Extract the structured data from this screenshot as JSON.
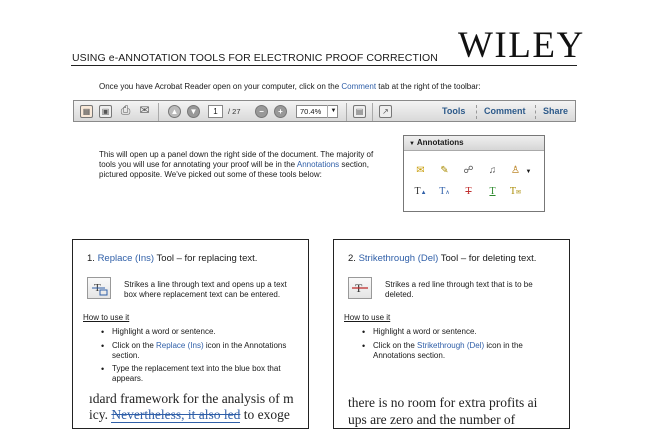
{
  "header": {
    "title": "USING e-ANNOTATION TOOLS FOR ELECTRONIC PROOF CORRECTION",
    "logo": "WILEY"
  },
  "intro": {
    "before": "Once you have Acrobat Reader open on your computer, click on the ",
    "link": "Comment",
    "after": " tab at the right of the toolbar:"
  },
  "toolbar": {
    "icons": [
      "create-pdf-icon",
      "save-icon",
      "print-icon",
      "email-icon",
      "page-up-icon",
      "page-down-icon",
      "zoom-out-icon",
      "zoom-in-icon",
      "fit-page-icon",
      "read-mode-icon"
    ],
    "page_value": "1",
    "page_total": "/ 27",
    "zoom_value": "70.4%",
    "tools_label": "Tools",
    "comment_label": "Comment",
    "share_label": "Share"
  },
  "panel_text": {
    "line1": "This will open up a panel down the right side of the document. The majority of",
    "line2_before": "tools you will use for annotating your proof will be in the ",
    "line2_link": "Annotations",
    "line2_after": " section,",
    "line3": "pictured opposite. We've picked out some of these tools below:"
  },
  "annotations_panel": {
    "title": "Annotations",
    "icons": [
      "sticky-note-icon",
      "highlight-icon",
      "attach-file-icon",
      "record-audio-icon",
      "stamp-icon",
      "replace-text-icon",
      "insert-text-icon",
      "strikethrough-icon",
      "underline-icon",
      "add-note-to-text-icon"
    ]
  },
  "box1": {
    "number": "1. ",
    "tool_link": "Replace (Ins)",
    "tool_rest": " Tool – for replacing text.",
    "desc_line1": "Strikes a line through text and opens up a text",
    "desc_line2": "box where replacement text can be entered.",
    "how_label": "How to use it",
    "bullet1": "Highlight a word or sentence.",
    "bullet2_before": "Click on the ",
    "bullet2_link": "Replace (Ins)",
    "bullet2_after": " icon in the Annotations",
    "bullet2_line2": "section.",
    "bullet3_line1": "Type the replacement text into the blue box that",
    "bullet3_line2": "appears.",
    "sample_line1": "ıdard framework for the analysis of m",
    "sample_line2_a": "icy. ",
    "sample_line2_strike": "Nevertheless, it also led",
    "sample_line2_b": " to exoge"
  },
  "box2": {
    "number": "2. ",
    "tool_link": "Strikethrough (Del)",
    "tool_rest": " Tool – for deleting text.",
    "desc_line1": "Strikes a red line through text that is to be",
    "desc_line2": "deleted.",
    "how_label": "How to use it",
    "bullet1": "Highlight a word or sentence.",
    "bullet2_before": "Click on the ",
    "bullet2_link": "Strikethrough (Del)",
    "bullet2_after": " icon in the",
    "bullet2_line2": "Annotations section.",
    "sample_line1": "there is no room for extra profits ai",
    "sample_line2": "ups are zero and the number of"
  },
  "colors": {
    "link": "#2f5fa8",
    "toolbar_text": "#2d5a8a"
  }
}
